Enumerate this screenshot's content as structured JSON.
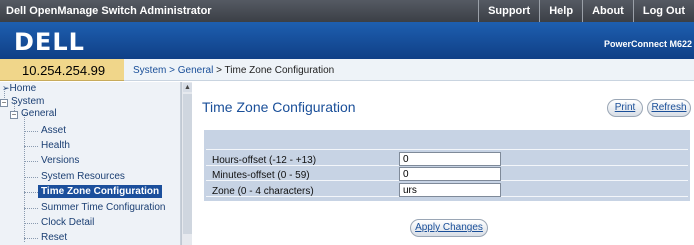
{
  "header": {
    "title": "Dell OpenManage Switch Administrator",
    "links": [
      "Support",
      "Help",
      "About",
      "Log Out"
    ],
    "logo": "DELL",
    "product": "PowerConnect M622"
  },
  "address": {
    "ip": "10.254.254.99",
    "breadcrumb": {
      "system": "System",
      "sep1": " > ",
      "general": "General",
      "sep2": " > ",
      "current": "Time Zone Configuration"
    }
  },
  "nav": {
    "home": "Home",
    "system": "System",
    "general": "General",
    "items": [
      "Asset",
      "Health",
      "Versions",
      "System Resources",
      "Time Zone Configuration",
      "Summer Time Configuration",
      "Clock Detail",
      "Reset"
    ]
  },
  "main": {
    "title": "Time Zone Configuration",
    "print": "Print",
    "refresh": "Refresh",
    "fields": [
      {
        "label": "Hours-offset (-12 - +13)",
        "value": "0"
      },
      {
        "label": "Minutes-offset (0 - 59)",
        "value": "0"
      },
      {
        "label": "Zone (0 - 4 characters)",
        "value": "urs"
      }
    ],
    "apply": "Apply Changes"
  }
}
